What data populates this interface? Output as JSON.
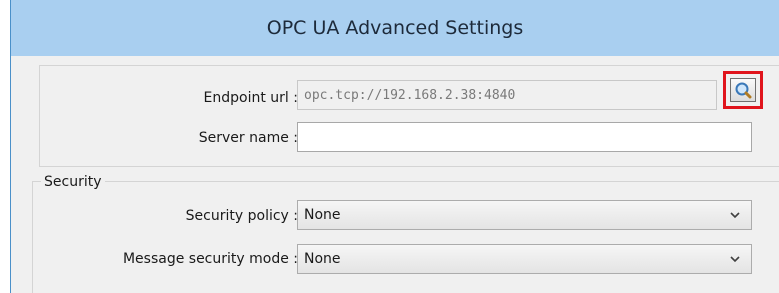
{
  "window": {
    "title": "OPC UA Advanced Settings"
  },
  "connection": {
    "endpoint_label": "Endpoint url :",
    "endpoint_value": "opc.tcp://192.168.2.38:4840",
    "server_name_label": "Server name :",
    "server_name_value": "",
    "browse_icon": "search-icon"
  },
  "security": {
    "group_label": "Security",
    "policy_label": "Security policy :",
    "policy_value": "None",
    "mode_label": "Message security mode :",
    "mode_value": "None"
  },
  "colors": {
    "titlebar": "#a9cff0",
    "highlight": "#e0141c"
  }
}
